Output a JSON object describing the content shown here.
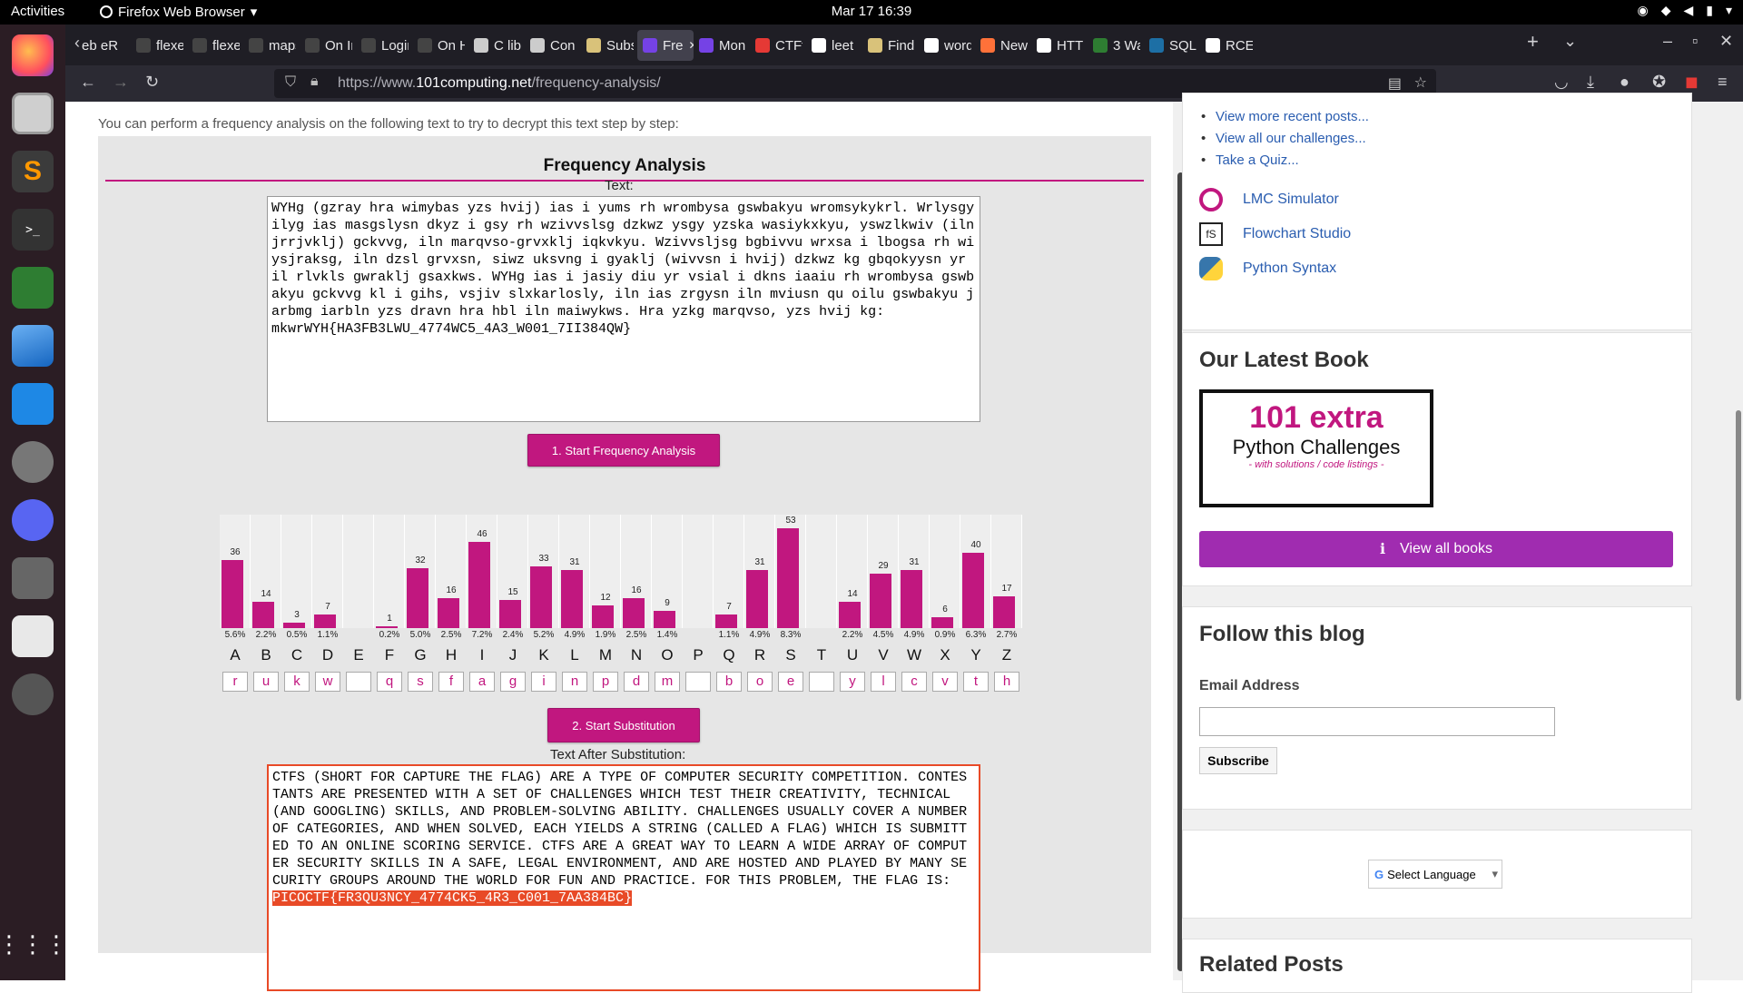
{
  "system": {
    "activities": "Activities",
    "app": "Firefox Web Browser",
    "clock": "Mar 17  16:39"
  },
  "tabs": [
    "eb eR",
    "flexed",
    "flexed",
    "maps.gc",
    "On Inclu",
    "Login Pa",
    "On Histi",
    "C libi",
    "Con",
    "Subs",
    "Fre",
    "Mon",
    "CTFt",
    "leet",
    "Find",
    "word",
    "New",
    "HTTI",
    "3 Wa",
    "SQL",
    "RCE"
  ],
  "url": {
    "prefix": "https://www.",
    "domain": "101computing.net",
    "path": "/frequency-analysis/"
  },
  "main": {
    "intro": "You can perform a frequency analysis on the following text to try to decrypt this text step by step:",
    "title": "Frequency Analysis",
    "text_label": "Text:",
    "cipher_text": "WYHg (gzray hra wimybas yzs hvij) ias i yums rh wrombysa gswbakyu wromsykykrl. Wrlysgyilyg ias masgslysn dkyz i gsy rh wzivvslsg dzkwz ysgy yzska wasiykxkyu, yswzlkwiv (iln jrrjvklj) gckvvg, iln marqvso-grvxklj iqkvkyu. Wzivvsljsg bgbivvu wrxsa i lbogsa rh wiysjraksg, iln dzsl grvxsn, siwz uksvng i gyaklj (wivvsn i hvij) dzkwz kg gbqokyysn yr il rlvkls gwraklj gsaxkws. WYHg ias i jasiy diu yr vsial i dkns iaaiu rh wrombysa gswbakyu gckvvg kl i gihs, vsjiv slxkarlosly, iln ias zrgysn iln mviusn qu oilu gswbakyu jarbmg iarbln yzs dravn hra hbl iln maiwykws. Hra yzkg marqvso, yzs hvij kg:\nmkwrWYH{HA3FB3LWU_4774WC5_4A3_W001_7II384QW}",
    "btn1": "1. Start Frequency Analysis",
    "btn2": "2. Start Substitution",
    "after_label": "Text After Substitution:",
    "plain_text": "CTFS (SHORT FOR CAPTURE THE FLAG) ARE A TYPE OF COMPUTER SECURITY COMPETITION. CONTESTANTS ARE PRESENTED WITH A SET OF CHALLENGES WHICH TEST THEIR CREATIVITY, TECHNICAL (AND GOOGLING) SKILLS, AND PROBLEM-SOLVING ABILITY. CHALLENGES USUALLY COVER A NUMBER OF CATEGORIES, AND WHEN SOLVED, EACH YIELDS A STRING (CALLED A FLAG) WHICH IS SUBMITTED TO AN ONLINE SCORING SERVICE. CTFS ARE A GREAT WAY TO LEARN A WIDE ARRAY OF COMPUTER SECURITY SKILLS IN A SAFE, LEGAL ENVIRONMENT, AND ARE HOSTED AND PLAYED BY MANY SECURITY GROUPS AROUND THE WORLD FOR FUN AND PRACTICE. FOR THIS PROBLEM, THE FLAG IS:",
    "flag": "PICOCTF{FR3QU3NCY_4774CK5_4R3_C001_7AA384BC}"
  },
  "freq": {
    "letters": [
      "A",
      "B",
      "C",
      "D",
      "E",
      "F",
      "G",
      "H",
      "I",
      "J",
      "K",
      "L",
      "M",
      "N",
      "O",
      "P",
      "Q",
      "R",
      "S",
      "T",
      "U",
      "V",
      "W",
      "X",
      "Y",
      "Z"
    ],
    "counts": [
      "36",
      "14",
      "3",
      "7",
      "",
      "1",
      "32",
      "16",
      "46",
      "15",
      "33",
      "31",
      "12",
      "16",
      "9",
      "",
      "7",
      "31",
      "53",
      "",
      "14",
      "29",
      "31",
      "6",
      "40",
      "17"
    ],
    "values": [
      36,
      14,
      3,
      7,
      0,
      1,
      32,
      16,
      46,
      15,
      33,
      31,
      12,
      16,
      9,
      0,
      7,
      31,
      53,
      0,
      14,
      29,
      31,
      6,
      40,
      17
    ],
    "percents": [
      "5.6%",
      "2.2%",
      "0.5%",
      "1.1%",
      "",
      "0.2%",
      "5.0%",
      "2.5%",
      "7.2%",
      "2.4%",
      "5.2%",
      "4.9%",
      "1.9%",
      "2.5%",
      "1.4%",
      "",
      "1.1%",
      "4.9%",
      "8.3%",
      "",
      "2.2%",
      "4.5%",
      "4.9%",
      "0.9%",
      "6.3%",
      "2.7%"
    ],
    "subs": [
      "r",
      "u",
      "k",
      "w",
      "",
      "q",
      "s",
      "f",
      "a",
      "g",
      "i",
      "n",
      "p",
      "d",
      "m",
      "",
      "b",
      "o",
      "e",
      "",
      "y",
      "l",
      "c",
      "v",
      "t",
      "h"
    ]
  },
  "side": {
    "links": [
      "View more recent posts...",
      "View all our challenges...",
      "Take a Quiz..."
    ],
    "tools": [
      "LMC Simulator",
      "Flowchart Studio",
      "Python Syntax"
    ],
    "book_heading": "Our Latest Book",
    "book_line1": "101 extra",
    "book_line2": "Python Challenges",
    "book_line3": "- with solutions / code listings -",
    "view_books": "View all books",
    "follow_heading": "Follow this blog",
    "email_label": "Email Address",
    "subscribe": "Subscribe",
    "select_language": "Select Language",
    "related": "Related Posts"
  },
  "colors": {
    "accent": "#c1177f",
    "flag_highlight": "#e84a27"
  }
}
